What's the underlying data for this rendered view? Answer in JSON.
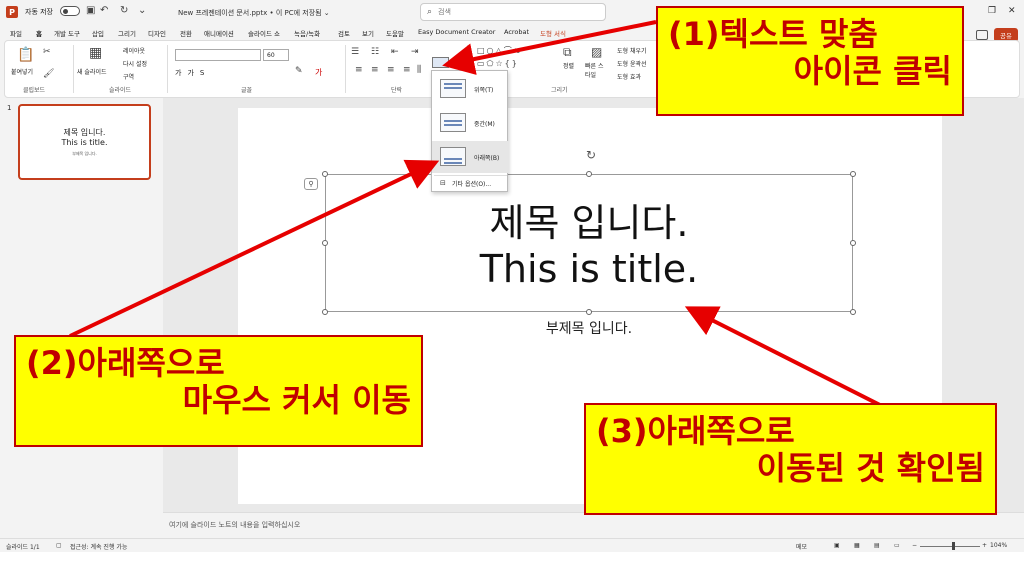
{
  "titlebar": {
    "app_logo": "P",
    "autosave_label": "자동 저장",
    "autosave_state": "끔",
    "filename": "New 프레젠테이션 문서.pptx • 이 PC에 저장됨 ⌄",
    "search_placeholder": "검색"
  },
  "tabs": [
    {
      "label": "파일"
    },
    {
      "label": "홈"
    },
    {
      "label": "개발 도구"
    },
    {
      "label": "삽입"
    },
    {
      "label": "그리기"
    },
    {
      "label": "디자인"
    },
    {
      "label": "전환"
    },
    {
      "label": "애니메이션"
    },
    {
      "label": "슬라이드 쇼"
    },
    {
      "label": "녹음/녹화"
    },
    {
      "label": "검토"
    },
    {
      "label": "보기"
    },
    {
      "label": "도움말"
    },
    {
      "label": "Easy Document Creator"
    },
    {
      "label": "Acrobat"
    },
    {
      "label": "도형 서식"
    }
  ],
  "share_label": "공유",
  "ribbon": {
    "paste": "붙여넣기",
    "clipboard": "클립보드",
    "new_slide": "새 슬라이드",
    "layout": "레이아웃",
    "reset": "다시 설정",
    "section": "구역",
    "slides_group": "슬라이드",
    "font_size": "60",
    "font_group": "글꼴",
    "paragraph_group": "단락",
    "drawing_group": "그리기",
    "arrange": "정렬",
    "quick_styles": "빠른 스타일",
    "shape_fill": "도형 채우기",
    "shape_outline": "도형 윤곽선",
    "shape_effects": "도형 효과"
  },
  "dropdown": {
    "top": "위쪽(T)",
    "middle": "중간(M)",
    "bottom": "아래쪽(B)",
    "more": "기타 옵션(O)..."
  },
  "slide_panel": {
    "number": "1",
    "thumb_title_1": "제목 입니다.",
    "thumb_title_2": "This is title.",
    "thumb_subtitle": "부제목 입니다."
  },
  "slide": {
    "title_line1": "제목 입니다.",
    "title_line2": "This is title.",
    "subtitle": "부제목 입니다."
  },
  "notes_placeholder": "여기에 슬라이드 노트의 내용을 입력하십시오",
  "status": {
    "slide_count": "슬라이드 1/1",
    "accessibility": "접근성: 계속 진행 가능",
    "notes_btn": "메모",
    "zoom": "104%"
  },
  "callouts": {
    "c1_line1": "(1)텍스트 맞춤",
    "c1_line2": "아이콘 클릭",
    "c2_line1": "(2)아래쪽으로",
    "c2_line2": "마우스 커서 이동",
    "c3_line1": "(3)아래쪽으로",
    "c3_line2": "이동된 것 확인됨"
  },
  "colors": {
    "accent": "#c43e1c",
    "callout_bg": "#ffff00",
    "callout_text": "#c00000",
    "arrow": "#e60000"
  }
}
